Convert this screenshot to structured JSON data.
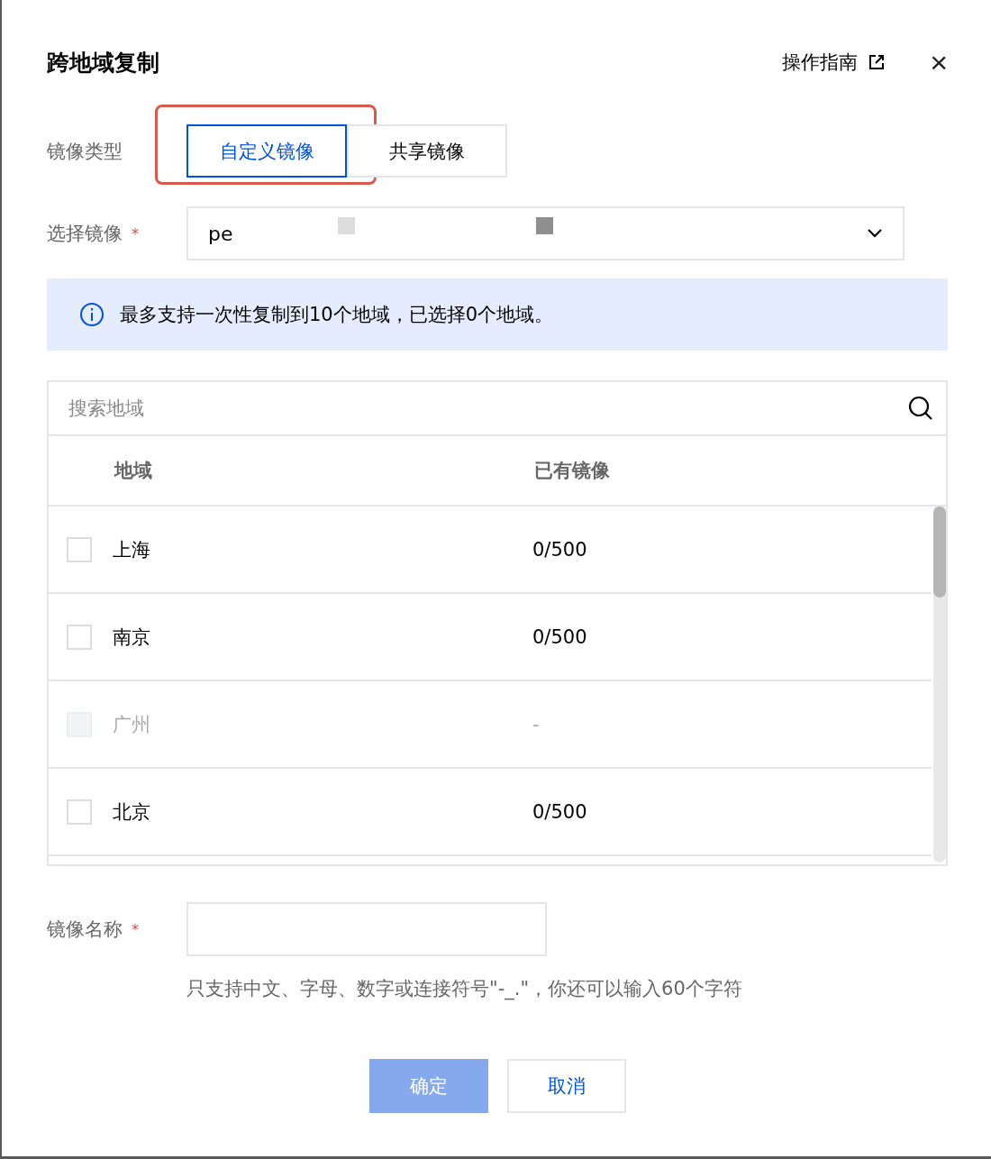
{
  "dialog": {
    "title": "跨地域复制",
    "guide_link": "操作指南",
    "close": "×"
  },
  "image_type": {
    "label": "镜像类型",
    "options": [
      {
        "label": "自定义镜像",
        "selected": true,
        "highlighted": true
      },
      {
        "label": "共享镜像",
        "selected": false,
        "highlighted": false
      }
    ]
  },
  "image_select": {
    "label": "选择镜像",
    "required_mark": "*",
    "value": "pe"
  },
  "notice": {
    "text": "最多支持一次性复制到10个地域，已选择0个地域。"
  },
  "region_table": {
    "search": {
      "placeholder": "搜索地域"
    },
    "columns": [
      "地域",
      "已有镜像"
    ],
    "rows": [
      {
        "region": "上海",
        "images": "0/500",
        "checked": false,
        "disabled": false
      },
      {
        "region": "南京",
        "images": "0/500",
        "checked": false,
        "disabled": false
      },
      {
        "region": "广州",
        "images": "-",
        "checked": false,
        "disabled": true
      },
      {
        "region": "北京",
        "images": "0/500",
        "checked": false,
        "disabled": false
      }
    ]
  },
  "image_name": {
    "label": "镜像名称",
    "required_mark": "*",
    "hint": "只支持中文、字母、数字或连接符号\"-_.\"，你还可以输入60个字符"
  },
  "buttons": [
    {
      "label": "确定",
      "kind": "primary",
      "disabled": true
    },
    {
      "label": "取消",
      "kind": "secondary",
      "disabled": false
    }
  ]
}
